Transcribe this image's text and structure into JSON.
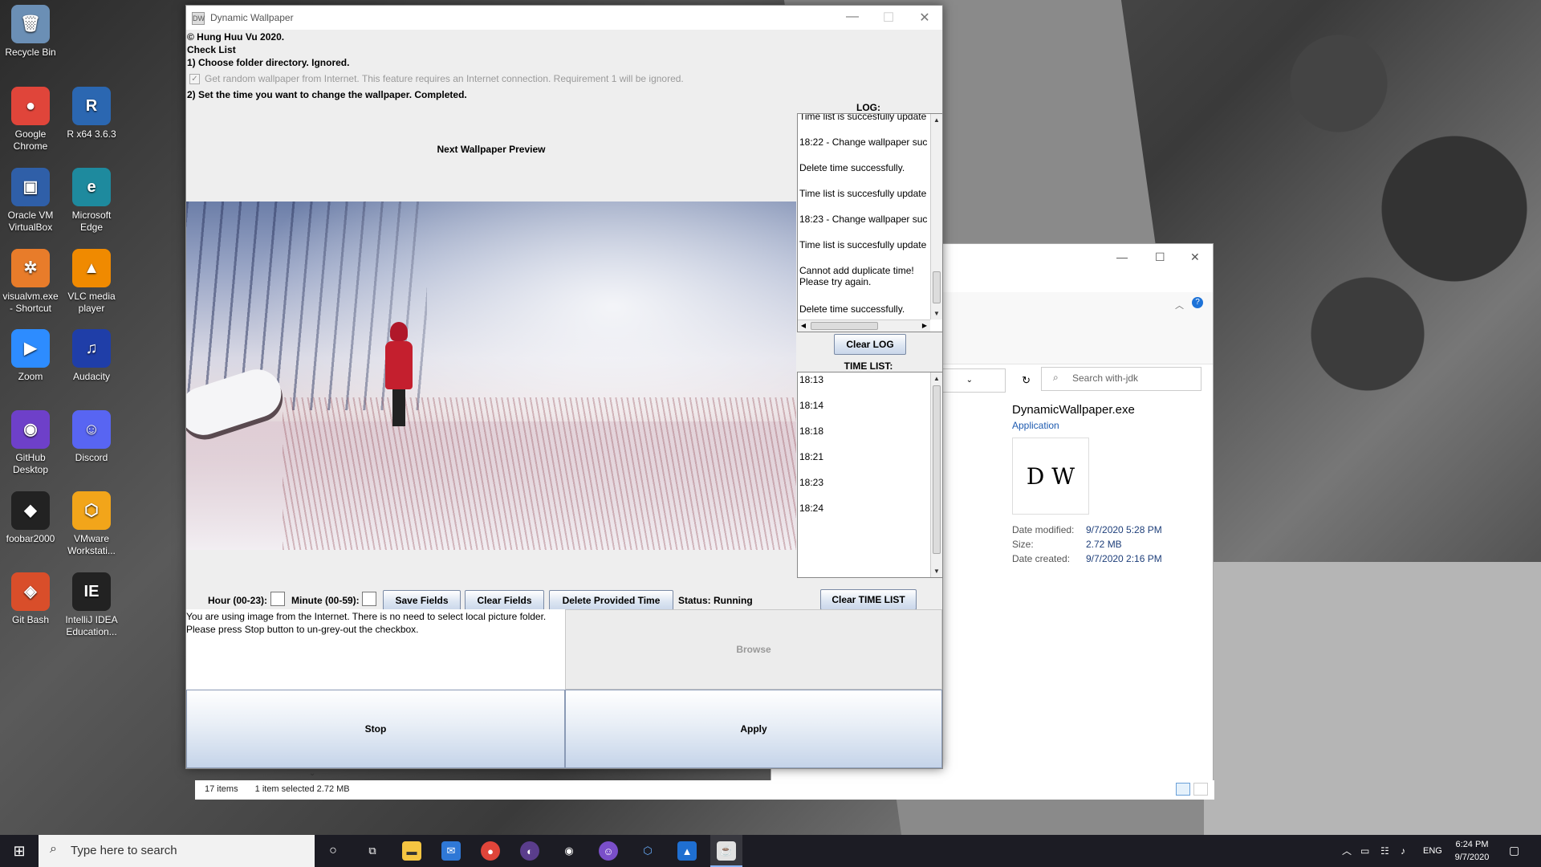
{
  "desktop": {
    "icons": [
      {
        "label": "Recycle Bin",
        "glyph": "🗑",
        "color": "#6b8fb5"
      },
      {
        "label": "Google Chrome",
        "glyph": "●",
        "color": "#e0453a"
      },
      {
        "label": "R x64 3.6.3",
        "glyph": "R",
        "color": "#2b67b1"
      },
      {
        "label": "Oracle VM VirtualBox",
        "glyph": "▣",
        "color": "#2f5fa8"
      },
      {
        "label": "Microsoft Edge",
        "glyph": "e",
        "color": "#1e8a9e"
      },
      {
        "label": "visualvm.exe - Shortcut",
        "glyph": "✲",
        "color": "#e87c2a"
      },
      {
        "label": "VLC media player",
        "glyph": "▲",
        "color": "#f08a00"
      },
      {
        "label": "Zoom",
        "glyph": "▶",
        "color": "#2d8cff"
      },
      {
        "label": "Audacity",
        "glyph": "♫",
        "color": "#1f3ea8"
      },
      {
        "label": "GitHub Desktop",
        "glyph": "◉",
        "color": "#6e40c9"
      },
      {
        "label": "Discord",
        "glyph": "☺",
        "color": "#5865f2"
      },
      {
        "label": "foobar2000",
        "glyph": "◆",
        "color": "#222"
      },
      {
        "label": "VMware Workstati...",
        "glyph": "⬡",
        "color": "#f2a51a"
      },
      {
        "label": "Git Bash",
        "glyph": "◈",
        "color": "#d94e2a"
      },
      {
        "label": "IntelliJ IDEA Education...",
        "glyph": "IE",
        "color": "#222"
      }
    ]
  },
  "explorer": {
    "search_placeholder": "Search with-jdk",
    "file_name": "DynamicWallpaper.exe",
    "file_type": "Application",
    "thumb_text": "D W",
    "date_modified_label": "Date modified:",
    "date_modified": "9/7/2020 5:28 PM",
    "size_label": "Size:",
    "size": "2.72 MB",
    "date_created_label": "Date created:",
    "date_created": "9/7/2020 2:16 PM",
    "status_items": "17 items",
    "status_selected": "1 item selected  2.72 MB"
  },
  "app": {
    "title": "Dynamic Wallpaper",
    "copyright": "© Hung Huu Vu 2020.",
    "checklist_title": "Check List",
    "req1": "1) Choose folder directory. Ignored.",
    "random_checkbox": "Get random wallpaper from Internet. This feature requires an Internet connection. Requirement 1 will be ignored.",
    "req2": "2) Set the time you want to change the wallpaper. Completed.",
    "preview_label": "Next Wallpaper Preview",
    "log_title": "LOG:",
    "log_entries": [
      "Time list is succesfully update",
      "18:22 - Change wallpaper suc",
      "Delete time successfully.",
      "Time list is succesfully update",
      "18:23 - Change wallpaper suc",
      "Time list is succesfully update",
      "Cannot add duplicate time!\nPlease try again.",
      "Delete time successfully."
    ],
    "clear_log": "Clear LOG",
    "time_list_title": "TIME LIST:",
    "times": [
      "18:13",
      "18:14",
      "18:18",
      "18:21",
      "18:23",
      "18:24"
    ],
    "hour_label": "Hour (00-23):",
    "minute_label": "Minute (00-59):",
    "save_fields": "Save Fields",
    "clear_fields": "Clear Fields",
    "delete_time": "Delete Provided Time",
    "status": "Status: Running",
    "clear_time_list": "Clear TIME LIST",
    "message_line1": "You are using image from the Internet. There is no need to select local picture folder.",
    "message_line2": "Please press Stop button to un-grey-out the checkbox.",
    "browse": "Browse",
    "stop": "Stop",
    "apply": "Apply"
  },
  "taskbar": {
    "search_placeholder": "Type here to search",
    "lang": "ENG",
    "time": "6:24 PM",
    "date": "9/7/2020"
  }
}
